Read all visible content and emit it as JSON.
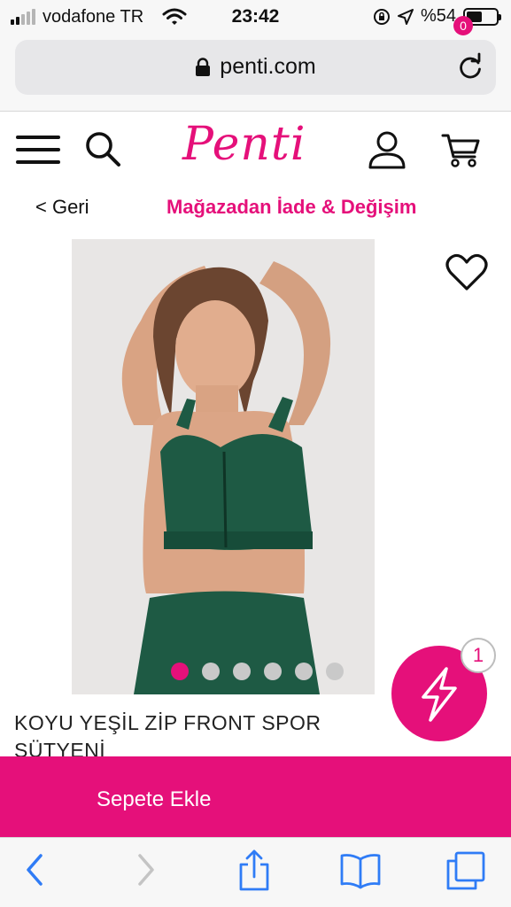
{
  "status_bar": {
    "carrier": "vodafone TR",
    "time": "23:42",
    "battery_percent": "%54",
    "battery_level": 0.54,
    "signal_bars": 2
  },
  "browser": {
    "url": "penti.com"
  },
  "header": {
    "logo": "Penti",
    "cart_count": "0"
  },
  "nav": {
    "back_label": "< Geri",
    "return_label": "Mağazadan İade & Değişim"
  },
  "product": {
    "title": "KOYU YEŞİL ZİP FRONT SPOR SÜTYENİ",
    "image_count": 6,
    "active_image": 1
  },
  "floating": {
    "badge": "1"
  },
  "actions": {
    "add_to_cart": "Sepete Ekle"
  },
  "colors": {
    "brand": "#e5107a",
    "toolbar_blue": "#2f7cf6",
    "top_green": "#1e5a44"
  }
}
